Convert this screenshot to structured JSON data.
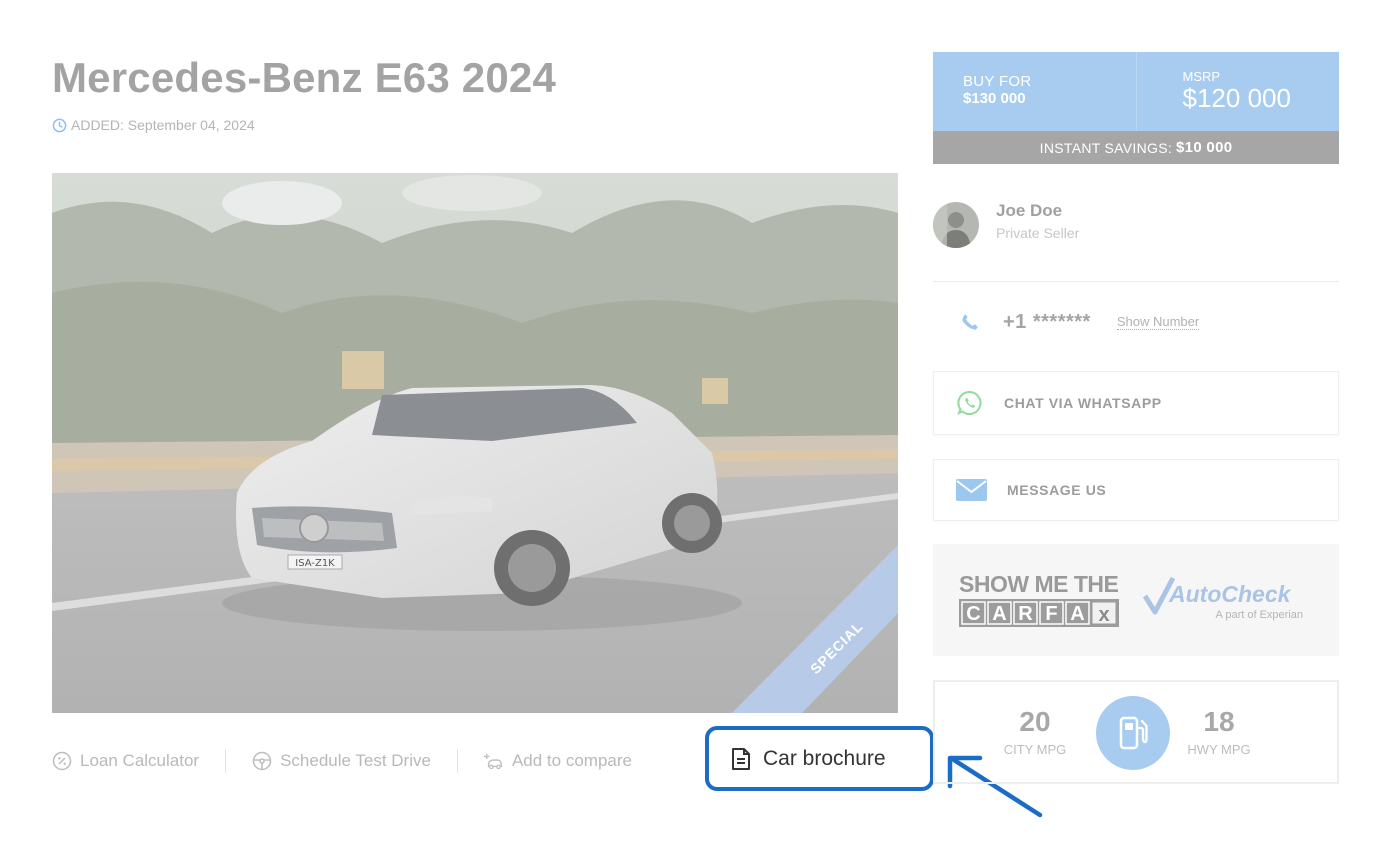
{
  "listing": {
    "title": "Mercedes-Benz E63 2024",
    "added": "ADDED: September 04, 2024",
    "badge": "SPECIAL",
    "plate": "ISA-Z1K"
  },
  "actions": [
    {
      "label": "Loan Calculator",
      "icon": "percent-icon"
    },
    {
      "label": "Schedule Test Drive",
      "icon": "steering-wheel-icon"
    },
    {
      "label": "Add to compare",
      "icon": "compare-car-icon"
    }
  ],
  "brochure": {
    "label": "Car brochure",
    "icon": "document-icon"
  },
  "price": {
    "buy_label": "BUY FOR",
    "buy_value": "$130 000",
    "msrp_label": "MSRP",
    "msrp_value": "$120 000",
    "savings_label": "INSTANT SAVINGS:",
    "savings_value": "$10 000"
  },
  "seller": {
    "name": "Joe Doe",
    "type": "Private Seller"
  },
  "phone": {
    "number": "+1 *******",
    "show_label": "Show Number"
  },
  "contact": {
    "whatsapp_label": "CHAT VIA WHATSAPP",
    "message_label": "MESSAGE US"
  },
  "reports": {
    "carfax_line1": "SHOW ME THE",
    "carfax_letters": [
      "C",
      "A",
      "R",
      "F",
      "A",
      "x"
    ],
    "autocheck_name": "AutoCheck",
    "autocheck_sub": "A part of Experian"
  },
  "mpg": {
    "city_value": "20",
    "city_label": "CITY MPG",
    "hwy_value": "18",
    "hwy_label": "HWY MPG"
  },
  "colors": {
    "accent_blue": "#a7ccf0",
    "highlight_border": "#1a6cc4",
    "savings_bar": "#a6a6a6"
  }
}
